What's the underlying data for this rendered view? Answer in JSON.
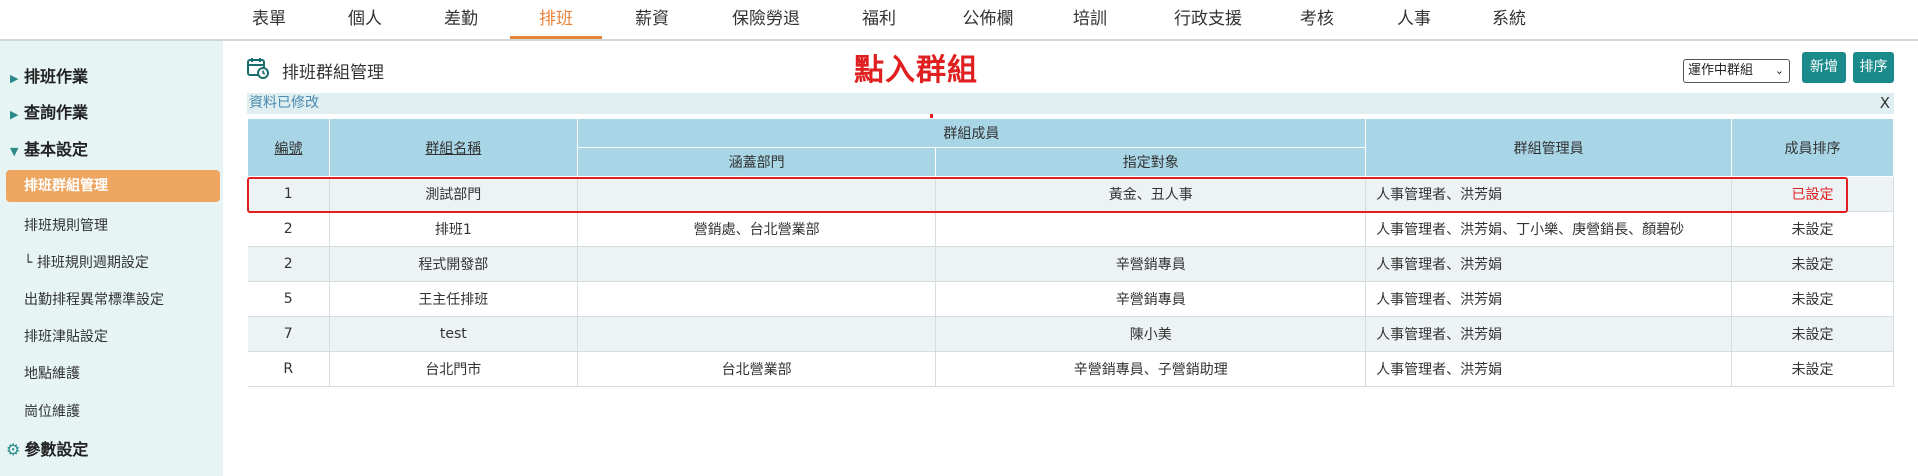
{
  "nav": {
    "items": [
      "表單",
      "個人",
      "差勤",
      "排班",
      "薪資",
      "保險勞退",
      "福利",
      "公佈欄",
      "培訓",
      "行政支援",
      "考核",
      "人事",
      "系統"
    ],
    "active_index": 3,
    "active_color": "#e8833a"
  },
  "sidebar": {
    "cat1": "排班作業",
    "cat2": "查詢作業",
    "cat3": "基本設定",
    "active_item": "排班群組管理",
    "items": [
      "排班規則管理",
      "└ 排班規則週期設定",
      "出勤排程異常標準設定",
      "排班津貼設定",
      "地點維護",
      "崗位維護"
    ],
    "cat4": "參數設定"
  },
  "header": {
    "title": "排班群組管理",
    "filter_value": "運作中群組",
    "add_label": "新增",
    "sort_label": "排序",
    "button_color": "#1b8a8a"
  },
  "annotation": {
    "text": "點入群組",
    "color": "#e02020"
  },
  "notice": {
    "text": "資料已修改",
    "close": "X"
  },
  "table": {
    "headers": {
      "id": "編號",
      "name": "群組名稱",
      "members": "群組成員",
      "dept": "涵蓋部門",
      "target": "指定對象",
      "admin": "群組管理員",
      "order": "成員排序"
    },
    "rows": [
      {
        "id": "1",
        "name": "測試部門",
        "dept": "",
        "target": "黃金、丑人事",
        "admin": "人事管理者、洪芳娟",
        "order": "已設定"
      },
      {
        "id": "2",
        "name": "排班1",
        "dept": "營銷處、台北營業部",
        "target": "",
        "admin": "人事管理者、洪芳娟、丁小樂、庚營銷長、顏碧砂",
        "order": "未設定"
      },
      {
        "id": "2",
        "name": "程式開發部",
        "dept": "",
        "target": "辛營銷專員",
        "admin": "人事管理者、洪芳娟",
        "order": "未設定"
      },
      {
        "id": "5",
        "name": "王主任排班",
        "dept": "",
        "target": "辛營銷專員",
        "admin": "人事管理者、洪芳娟",
        "order": "未設定"
      },
      {
        "id": "7",
        "name": "test",
        "dept": "",
        "target": "陳小美",
        "admin": "人事管理者、洪芳娟",
        "order": "未設定"
      },
      {
        "id": "R",
        "name": "台北門市",
        "dept": "台北營業部",
        "target": "辛營銷專員、子營銷助理",
        "admin": "人事管理者、洪芳娟",
        "order": "未設定"
      }
    ]
  }
}
